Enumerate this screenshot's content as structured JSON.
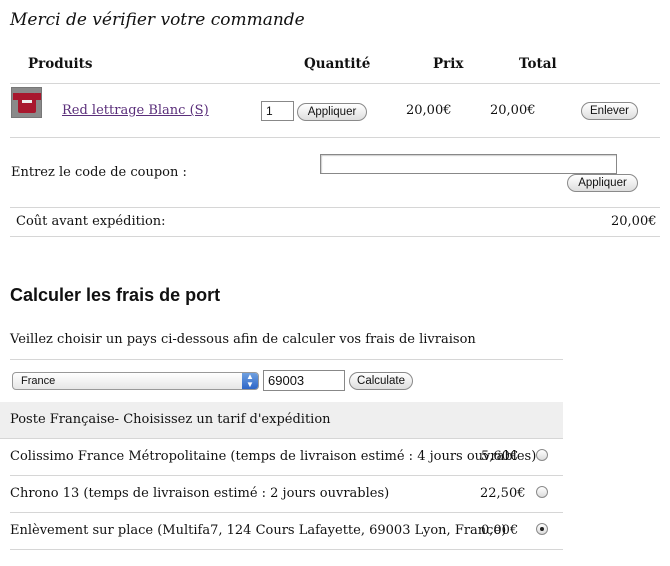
{
  "cart": {
    "title": "Merci de vérifier votre commande",
    "headers": {
      "product": "Produits",
      "quantity": "Quantité",
      "price": "Prix",
      "total": "Total"
    },
    "item": {
      "thumbnail_icon": "tshirt-thumbnail",
      "name": "Red lettrage Blanc (S)",
      "quantity": "1",
      "apply_label": "Appliquer",
      "price": "20,00€",
      "total": "20,00€",
      "remove_label": "Enlever"
    },
    "coupon": {
      "label": "Entrez le code de coupon :",
      "value": "",
      "apply_label": "Appliquer"
    },
    "subtotal": {
      "label": "Coût avant expédition:",
      "value": "20,00€"
    }
  },
  "shipping": {
    "heading": "Calculer les frais de port",
    "instruction": "Veillez choisir un pays ci-dessous afin de calculer vos frais de livraison",
    "country": "France",
    "postal_code": "69003",
    "calculate_label": "Calculate",
    "carrier_header": "Poste Française- Choisissez un tarif d'expédition",
    "options": [
      {
        "label": "Colissimo France Métropolitaine (temps de livraison estimé : 4 jours ouvrables)",
        "price": "5,60€",
        "selected": false
      },
      {
        "label": "Chrono 13 (temps de livraison estimé : 2 jours ouvrables)",
        "price": "22,50€",
        "selected": false
      },
      {
        "label": "Enlèvement sur place (Multifa7, 124 Cours Lafayette, 69003 Lyon, France)",
        "price": "0,00€",
        "selected": true
      }
    ]
  }
}
